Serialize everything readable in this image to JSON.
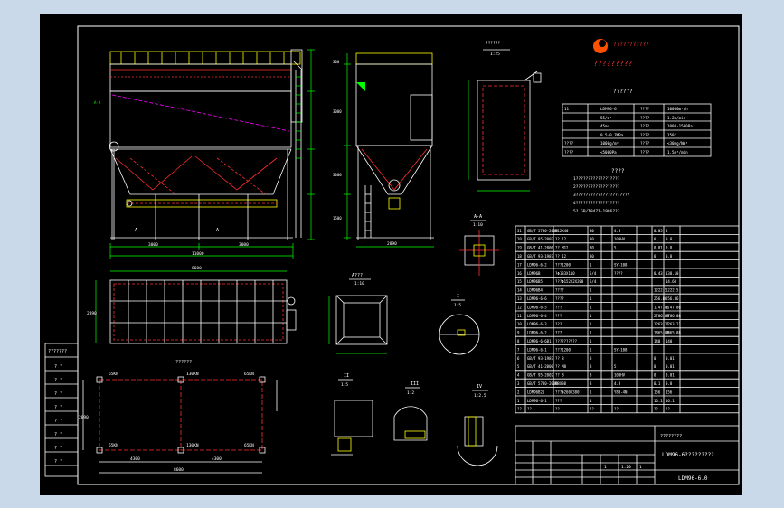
{
  "title_block": {
    "logo_text": "???????????",
    "company_name": "?????????",
    "drawing_name": "LDM96-6?????????",
    "drawing_number": "LDM96-6.0",
    "scale_label": "1:20",
    "count_label": "1",
    "sheet_label": "1",
    "extra_mark": "????????"
  },
  "spec_table": {
    "title": "??????",
    "rows": [
      [
        "11",
        "LDM96-6",
        "????",
        "10000m³/h"
      ],
      [
        "",
        "55/m²",
        "????",
        "1.2m/min"
      ],
      [
        "",
        "45m²",
        "????",
        "1000-1500Pa"
      ],
      [
        "",
        "0.5-0.7MPa",
        "????",
        "150°"
      ],
      [
        "????",
        "1000g/m²",
        "????",
        "<30mg/Nm³"
      ],
      [
        "????",
        "<5000Pa",
        "????",
        "1.5m³/min"
      ]
    ]
  },
  "notes": {
    "title": "????",
    "lines": [
      "1??????????????????",
      "2??????????????????",
      "3??????????????????????",
      "4??????????????????",
      "5? GB/T8471-1986???"
    ]
  },
  "parts_list": {
    "rows": [
      [
        "31",
        "GB/T 5780-2000",
        "M12X40",
        "80",
        "",
        "4.8",
        "",
        "0.05",
        "4"
      ],
      [
        "20",
        "GB/T 95-2002",
        "?? 12",
        "80",
        "",
        "100HV",
        "",
        "0",
        "0.8"
      ],
      [
        "19",
        "GB/T 41-2000",
        "?? M12",
        "80",
        "",
        "5",
        "",
        "0.01",
        "0.8"
      ],
      [
        "18",
        "GB/T 93-1987",
        "?? 12",
        "80",
        "",
        "",
        "",
        "0",
        "0.8"
      ],
      [
        "17",
        "LDM96-6-2",
        "???1200",
        "1",
        "",
        "SY-108",
        "",
        "",
        ""
      ],
      [
        "16",
        "LDM96B",
        "?Φ133X110",
        "5/4",
        "",
        "????",
        "",
        "0.43",
        "138.10"
      ],
      [
        "15",
        "LDM96B5",
        "???Φ152X2X200",
        "5/4",
        "",
        "",
        "",
        "",
        "14.60"
      ],
      [
        "14",
        "LDM96B4",
        "????",
        "1",
        "",
        "",
        "",
        "1222.5",
        "1222.5"
      ],
      [
        "13",
        "LDM96-6-6",
        "????",
        "1",
        "",
        "",
        "",
        "256.86",
        "256.86"
      ],
      [
        "12",
        "LDM96-6-5",
        "???",
        "1",
        "",
        "",
        "",
        "1.47.86",
        "1.47.86"
      ],
      [
        "11",
        "LDM96-6-4",
        "???",
        "1",
        "",
        "",
        "",
        "2786.08",
        "2786.08"
      ],
      [
        "10",
        "LDM96-6-3",
        "???",
        "1",
        "",
        "",
        "",
        "1263.21",
        "1263.21"
      ],
      [
        "9",
        "LDM96-6-2",
        "???",
        "1",
        "",
        "",
        "",
        "1865.08",
        "1865.08"
      ],
      [
        "8",
        "LDM96-6-6B1",
        "??????????",
        "1",
        "",
        "",
        "",
        "140",
        "140"
      ],
      [
        "7",
        "LDM96-6-1",
        "???1200",
        "1",
        "",
        "SY-108",
        "",
        "",
        ""
      ],
      [
        "6",
        "GB/T 93-1987",
        "?? 8",
        "8",
        "",
        "",
        "",
        "0",
        "0.01"
      ],
      [
        "5",
        "GB/T 41-2000",
        "?? M8",
        "8",
        "",
        "5",
        "",
        "0",
        "0.01"
      ],
      [
        "4",
        "GB/T 95-2002",
        "?? 8",
        "8",
        "",
        "100HV",
        "",
        "0",
        "0.01"
      ],
      [
        "3",
        "GB/T 5780-2000",
        "M8X30",
        "8",
        "",
        "4.8",
        "",
        "0.1",
        "0.8"
      ],
      [
        "2",
        "LDM96B21",
        "???Φ260X380",
        "1",
        "",
        "Y80-4N",
        "",
        "156",
        "156"
      ],
      [
        "1",
        "LDM96-6-1",
        "???",
        "1",
        "",
        "",
        "",
        "16.1",
        "16.1"
      ],
      [
        "??",
        "??",
        "??",
        "??",
        "",
        "??",
        "",
        "??",
        "??"
      ]
    ]
  },
  "views": {
    "front_elevation": {
      "width_dim": "11000",
      "spans": [
        "3000",
        "3000"
      ],
      "section_marks": [
        "A",
        "A"
      ],
      "left_mark": "A-A"
    },
    "side_elevation": {
      "width_dim": "2890",
      "heights": [
        "300",
        "3000",
        "3000",
        "1500"
      ]
    },
    "plan_view": {
      "width_dim": "8600",
      "depth_dim": "2890"
    },
    "load_plan": {
      "title": "??????",
      "loads": [
        "65KN",
        "130KN",
        "65KN",
        "65KN",
        "130KN",
        "65KN"
      ],
      "dims": [
        "4300",
        "4300",
        "8600",
        "2890"
      ]
    },
    "detail_top": {
      "label": "??????",
      "scale": "1:25"
    },
    "detail_aa": {
      "label": "A-A",
      "scale": "1:10"
    },
    "detail_A": {
      "label": "A???",
      "scale": "1:10"
    },
    "detail_I": {
      "label": "I",
      "scale": "1:5"
    },
    "detail_II": {
      "label": "II",
      "scale": "1:5"
    },
    "detail_III": {
      "label": "III",
      "scale": "1:2"
    },
    "detail_IV": {
      "label": "IV",
      "scale": "1:2.5"
    }
  },
  "left_margin_labels": [
    "???????",
    "? ?",
    "? ?",
    "? ?",
    "? ?",
    "? ?",
    "? ?",
    "? ?",
    "? ?",
    "? ?"
  ]
}
